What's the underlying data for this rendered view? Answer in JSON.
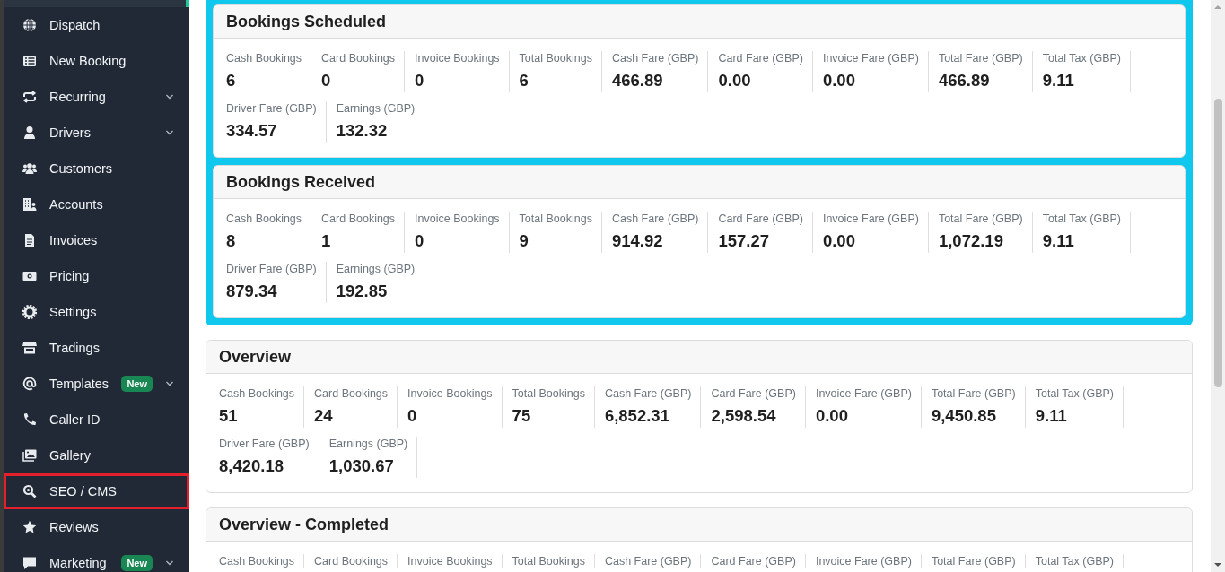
{
  "sidebar": {
    "items": [
      {
        "label": "Dispatch",
        "has_submenu": false,
        "highlighted": false
      },
      {
        "label": "New Booking",
        "has_submenu": false,
        "highlighted": false
      },
      {
        "label": "Recurring",
        "has_submenu": true,
        "highlighted": false
      },
      {
        "label": "Drivers",
        "has_submenu": true,
        "highlighted": false
      },
      {
        "label": "Customers",
        "has_submenu": false,
        "highlighted": false
      },
      {
        "label": "Accounts",
        "has_submenu": false,
        "highlighted": false
      },
      {
        "label": "Invoices",
        "has_submenu": false,
        "highlighted": false
      },
      {
        "label": "Pricing",
        "has_submenu": false,
        "highlighted": false
      },
      {
        "label": "Settings",
        "has_submenu": false,
        "highlighted": false
      },
      {
        "label": "Tradings",
        "has_submenu": false,
        "highlighted": false
      },
      {
        "label": "Templates",
        "badge": "New",
        "has_submenu": true,
        "highlighted": false
      },
      {
        "label": "Caller ID",
        "has_submenu": false,
        "highlighted": false
      },
      {
        "label": "Gallery",
        "has_submenu": false,
        "highlighted": false
      },
      {
        "label": "SEO / CMS",
        "has_submenu": false,
        "highlighted": true
      },
      {
        "label": "Reviews",
        "has_submenu": false,
        "highlighted": false
      },
      {
        "label": "Marketing",
        "badge": "New",
        "has_submenu": true,
        "highlighted": false
      }
    ]
  },
  "featured_panel": {
    "sections": [
      {
        "title": "Bookings Scheduled",
        "stats": [
          {
            "label": "Cash Bookings",
            "value": "6"
          },
          {
            "label": "Card Bookings",
            "value": "0"
          },
          {
            "label": "Invoice Bookings",
            "value": "0"
          },
          {
            "label": "Total Bookings",
            "value": "6"
          },
          {
            "label": "Cash Fare (GBP)",
            "value": "466.89"
          },
          {
            "label": "Card Fare (GBP)",
            "value": "0.00"
          },
          {
            "label": "Invoice Fare (GBP)",
            "value": "0.00"
          },
          {
            "label": "Total Fare (GBP)",
            "value": "466.89"
          },
          {
            "label": "Total Tax (GBP)",
            "value": "9.11"
          },
          {
            "label": "Driver Fare (GBP)",
            "value": "334.57"
          },
          {
            "label": "Earnings (GBP)",
            "value": "132.32"
          }
        ]
      },
      {
        "title": "Bookings Received",
        "stats": [
          {
            "label": "Cash Bookings",
            "value": "8"
          },
          {
            "label": "Card Bookings",
            "value": "1"
          },
          {
            "label": "Invoice Bookings",
            "value": "0"
          },
          {
            "label": "Total Bookings",
            "value": "9"
          },
          {
            "label": "Cash Fare (GBP)",
            "value": "914.92"
          },
          {
            "label": "Card Fare (GBP)",
            "value": "157.27"
          },
          {
            "label": "Invoice Fare (GBP)",
            "value": "0.00"
          },
          {
            "label": "Total Fare (GBP)",
            "value": "1,072.19"
          },
          {
            "label": "Total Tax (GBP)",
            "value": "9.11"
          },
          {
            "label": "Driver Fare (GBP)",
            "value": "879.34"
          },
          {
            "label": "Earnings (GBP)",
            "value": "192.85"
          }
        ]
      }
    ]
  },
  "sections": [
    {
      "title": "Overview",
      "stats": [
        {
          "label": "Cash Bookings",
          "value": "51"
        },
        {
          "label": "Card Bookings",
          "value": "24"
        },
        {
          "label": "Invoice Bookings",
          "value": "0"
        },
        {
          "label": "Total Bookings",
          "value": "75"
        },
        {
          "label": "Cash Fare (GBP)",
          "value": "6,852.31"
        },
        {
          "label": "Card Fare (GBP)",
          "value": "2,598.54"
        },
        {
          "label": "Invoice Fare (GBP)",
          "value": "0.00"
        },
        {
          "label": "Total Fare (GBP)",
          "value": "9,450.85"
        },
        {
          "label": "Total Tax (GBP)",
          "value": "9.11"
        },
        {
          "label": "Driver Fare (GBP)",
          "value": "8,420.18"
        },
        {
          "label": "Earnings (GBP)",
          "value": "1,030.67"
        }
      ]
    },
    {
      "title": "Overview - Completed",
      "stats": [
        {
          "label": "Cash Bookings"
        },
        {
          "label": "Card Bookings"
        },
        {
          "label": "Invoice Bookings"
        },
        {
          "label": "Total Bookings"
        },
        {
          "label": "Cash Fare (GBP)"
        },
        {
          "label": "Card Fare (GBP)"
        },
        {
          "label": "Invoice Fare (GBP)"
        },
        {
          "label": "Total Fare (GBP)"
        },
        {
          "label": "Total Tax (GBP)"
        }
      ]
    }
  ]
}
